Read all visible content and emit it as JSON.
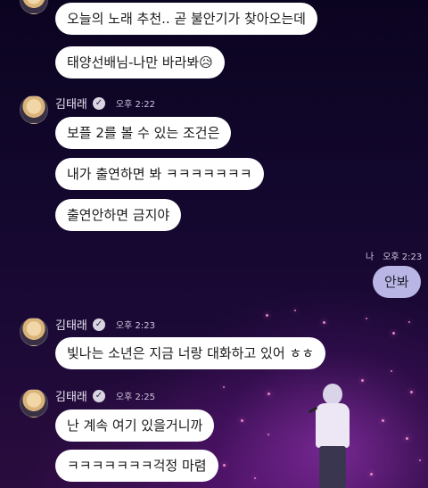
{
  "messages": {
    "top_1": "오늘의 노래 추천.. 곧 불안기가 찾아오는데",
    "top_2": "태양선배님-나만 바라봐😥",
    "group1": {
      "sender": "김태래",
      "time": "오후 2:22",
      "b1": "보플 2를 볼 수 있는 조건은",
      "b2": "내가 출연하면 봐 ㅋㅋㅋㅋㅋㅋㅋ",
      "b3": "출연안하면 금지야"
    },
    "me": {
      "label": "나",
      "time": "오후 2:23",
      "text": "안봐"
    },
    "group2": {
      "sender": "김태래",
      "time": "오후 2:23",
      "b1": "빛나는 소년은 지금 너랑 대화하고 있어 ㅎㅎ"
    },
    "group3": {
      "sender": "김태래",
      "time": "오후 2:25",
      "b1": "난 계속 여기 있을거니까",
      "b2": "ㅋㅋㅋㅋㅋㅋㅋ걱정 마렴"
    }
  },
  "icons": {
    "verified": "verified-check-icon"
  },
  "colors": {
    "bubble_other": "#ffffff",
    "bubble_me": "#b9b6e6",
    "background": "#12072c"
  }
}
